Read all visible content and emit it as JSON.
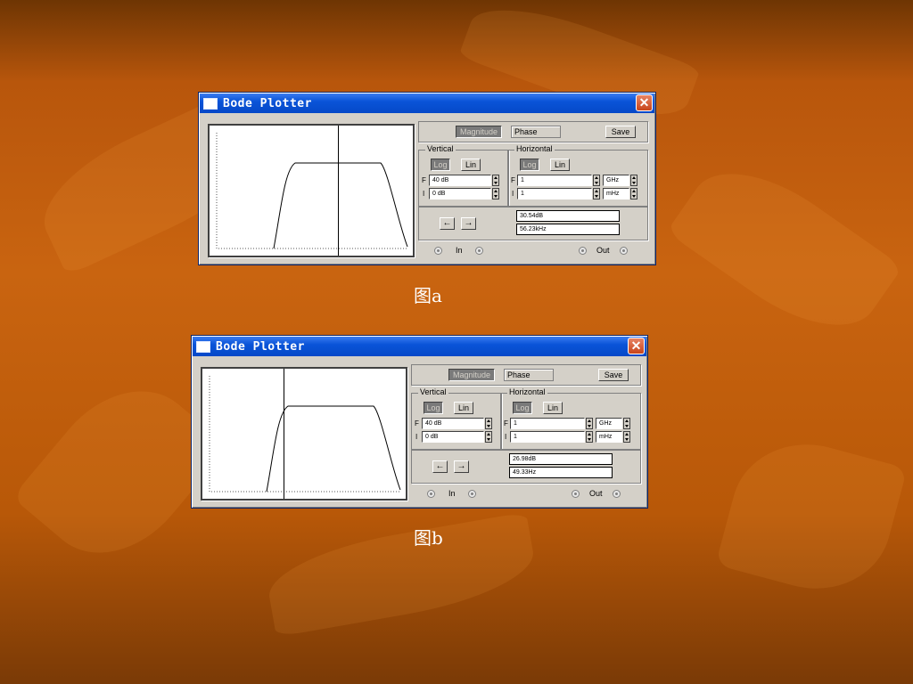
{
  "windows": [
    {
      "title": "Bode Plotter",
      "close_icon": "close-icon",
      "mode_buttons": {
        "magnitude": "Magnitude",
        "phase": "Phase",
        "save": "Save"
      },
      "vertical": {
        "label": "Vertical",
        "log": "Log",
        "lin": "Lin",
        "f_label": "F",
        "i_label": "I",
        "final": "40 dB",
        "initial": "0 dB"
      },
      "horizontal": {
        "label": "Horizontal",
        "log": "Log",
        "lin": "Lin",
        "f_label": "F",
        "i_label": "I",
        "final": "1",
        "initial": "1",
        "final_unit": "GHz",
        "initial_unit": "mHz"
      },
      "readout": {
        "gain": "30.54dB",
        "freq": "56.23kHz"
      },
      "terminals": {
        "in": "In",
        "out": "Out"
      },
      "cursor_fraction": 0.63,
      "caption": "图a"
    },
    {
      "title": "Bode Plotter",
      "close_icon": "close-icon",
      "mode_buttons": {
        "magnitude": "Magnitude",
        "phase": "Phase",
        "save": "Save"
      },
      "vertical": {
        "label": "Vertical",
        "log": "Log",
        "lin": "Lin",
        "f_label": "F",
        "i_label": "I",
        "final": "40 dB",
        "initial": "0 dB"
      },
      "horizontal": {
        "label": "Horizontal",
        "log": "Log",
        "lin": "Lin",
        "f_label": "F",
        "i_label": "I",
        "final": "1",
        "initial": "1",
        "final_unit": "GHz",
        "initial_unit": "mHz"
      },
      "readout": {
        "gain": "26.98dB",
        "freq": "49.33Hz"
      },
      "terminals": {
        "in": "In",
        "out": "Out"
      },
      "cursor_fraction": 0.4,
      "caption": "图b"
    }
  ],
  "colors": {
    "titlebar": "#0548c8",
    "close": "#c8441a",
    "window_face": "#d4d0c8",
    "background": "#c96410"
  }
}
